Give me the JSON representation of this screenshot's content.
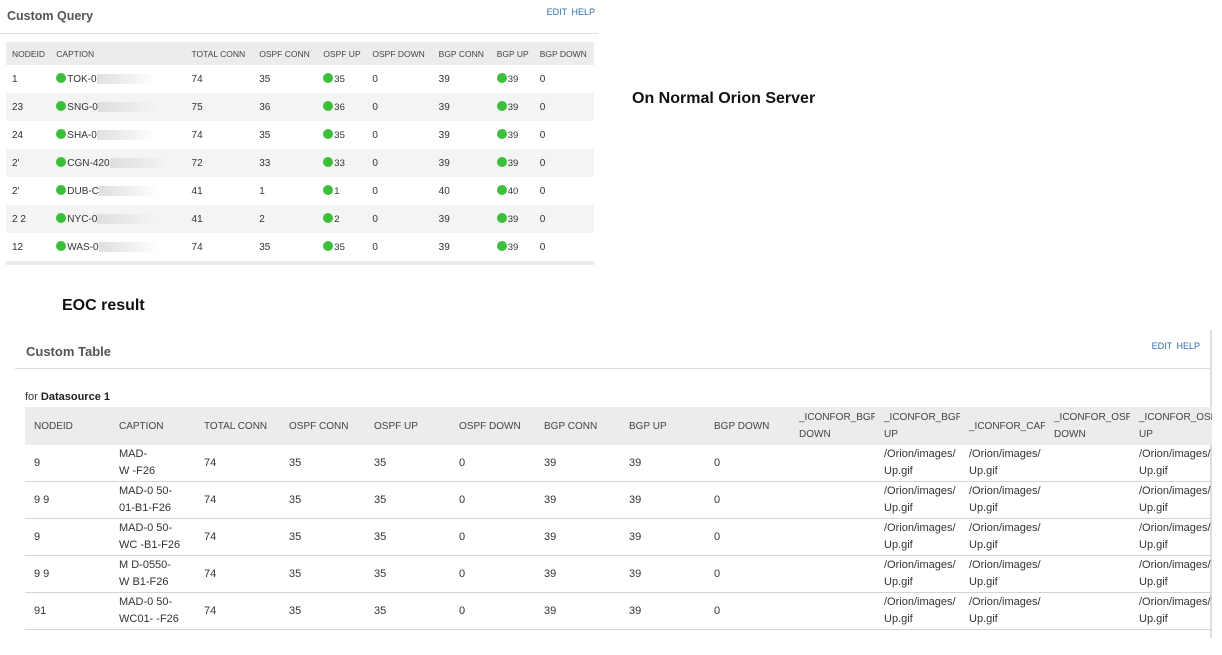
{
  "custom_query": {
    "title": "Custom Query",
    "edit_label": "EDIT",
    "help_label": "HELP",
    "columns": [
      "NODEID",
      "CAPTION",
      "TOTAL CONN",
      "OSPF CONN",
      "OSPF UP",
      "OSPF DOWN",
      "BGP CONN",
      "BGP UP",
      "BGP DOWN"
    ],
    "rows": [
      {
        "nodeid": "1",
        "caption": "TOK-0",
        "caption_tail": "00",
        "total_conn": "74",
        "ospf_conn": "35",
        "ospf_up": "35",
        "ospf_down": "0",
        "bgp_conn": "39",
        "bgp_up": "39",
        "bgp_down": "0"
      },
      {
        "nodeid": "23",
        "caption": "SNG-0",
        "caption_tail": "",
        "total_conn": "75",
        "ospf_conn": "36",
        "ospf_up": "36",
        "ospf_down": "0",
        "bgp_conn": "39",
        "bgp_up": "39",
        "bgp_down": "0"
      },
      {
        "nodeid": "24",
        "caption": "SHA-0",
        "caption_tail": "",
        "total_conn": "74",
        "ospf_conn": "35",
        "ospf_up": "35",
        "ospf_down": "0",
        "bgp_conn": "39",
        "bgp_up": "39",
        "bgp_down": "0"
      },
      {
        "nodeid": "2'",
        "caption": "CGN-420",
        "caption_tail": "",
        "total_conn": "72",
        "ospf_conn": "33",
        "ospf_up": "33",
        "ospf_down": "0",
        "bgp_conn": "39",
        "bgp_up": "39",
        "bgp_down": "0"
      },
      {
        "nodeid": "2'",
        "caption": "DUB-C",
        "caption_tail": "",
        "total_conn": "41",
        "ospf_conn": "1",
        "ospf_up": "1",
        "ospf_down": "0",
        "bgp_conn": "40",
        "bgp_up": "40",
        "bgp_down": "0"
      },
      {
        "nodeid": "2 2",
        "caption": "NYC-0",
        "caption_tail": "",
        "total_conn": "41",
        "ospf_conn": "2",
        "ospf_up": "2",
        "ospf_down": "0",
        "bgp_conn": "39",
        "bgp_up": "39",
        "bgp_down": "0"
      },
      {
        "nodeid": "12",
        "caption": "WAS-0",
        "caption_tail": "",
        "total_conn": "74",
        "ospf_conn": "35",
        "ospf_up": "35",
        "ospf_down": "0",
        "bgp_conn": "39",
        "bgp_up": "39",
        "bgp_down": "0"
      }
    ],
    "status_color": "#3bbf3b"
  },
  "labels": {
    "normal": "On Normal Orion Server",
    "eoc": "EOC result"
  },
  "custom_table": {
    "title": "Custom Table",
    "edit_label": "EDIT",
    "help_label": "HELP",
    "datasource_prefix": "for",
    "datasource_name": "Datasource 1",
    "columns": [
      [
        "NODEID"
      ],
      [
        "CAPTION"
      ],
      [
        "TOTAL CONN"
      ],
      [
        "OSPF CONN"
      ],
      [
        "OSPF UP"
      ],
      [
        "OSPF DOWN"
      ],
      [
        "BGP CONN"
      ],
      [
        "BGP UP"
      ],
      [
        "BGP DOWN"
      ],
      [
        "_ICONFOR_BGP",
        "DOWN"
      ],
      [
        "_ICONFOR_BGP",
        "UP"
      ],
      [
        "_ICONFOR_CAPTI"
      ],
      [
        "_ICONFOR_OSPF",
        "DOWN"
      ],
      [
        "_ICONFOR_OSPF",
        "UP"
      ]
    ],
    "rows": [
      {
        "nodeid": "9",
        "caption1": "MAD-",
        "caption2": "W  -F26",
        "total_conn": "74",
        "ospf_conn": "35",
        "ospf_up": "35",
        "ospf_down": "0",
        "bgp_conn": "39",
        "bgp_up": "39",
        "bgp_down": "0",
        "icon_bgp_down": "",
        "icon_bgp_up": [
          "/Orion/images/",
          "Up.gif"
        ],
        "icon_caption": [
          "/Orion/images/",
          "Up.gif"
        ],
        "icon_ospf_down": "",
        "icon_ospf_up": [
          "/Orion/images/",
          "Up.gif"
        ]
      },
      {
        "nodeid": "9 9",
        "caption1": "MAD-0 50-",
        "caption2": "01-B1-F26",
        "total_conn": "74",
        "ospf_conn": "35",
        "ospf_up": "35",
        "ospf_down": "0",
        "bgp_conn": "39",
        "bgp_up": "39",
        "bgp_down": "0",
        "icon_bgp_down": "",
        "icon_bgp_up": [
          "/Orion/images/",
          "Up.gif"
        ],
        "icon_caption": [
          "/Orion/images/",
          "Up.gif"
        ],
        "icon_ospf_down": "",
        "icon_ospf_up": [
          "/Orion/images/",
          "Up.gif"
        ]
      },
      {
        "nodeid": "9",
        "caption1": "MAD-0 50-",
        "caption2": "WC -B1-F26",
        "total_conn": "74",
        "ospf_conn": "35",
        "ospf_up": "35",
        "ospf_down": "0",
        "bgp_conn": "39",
        "bgp_up": "39",
        "bgp_down": "0",
        "icon_bgp_down": "",
        "icon_bgp_up": [
          "/Orion/images/",
          "Up.gif"
        ],
        "icon_caption": [
          "/Orion/images/",
          "Up.gif"
        ],
        "icon_ospf_down": "",
        "icon_ospf_up": [
          "/Orion/images/",
          "Up.gif"
        ]
      },
      {
        "nodeid": "9 9",
        "caption1": "M D-0550-",
        "caption2": "W B1-F26",
        "total_conn": "74",
        "ospf_conn": "35",
        "ospf_up": "35",
        "ospf_down": "0",
        "bgp_conn": "39",
        "bgp_up": "39",
        "bgp_down": "0",
        "icon_bgp_down": "",
        "icon_bgp_up": [
          "/Orion/images/",
          "Up.gif"
        ],
        "icon_caption": [
          "/Orion/images/",
          "Up.gif"
        ],
        "icon_ospf_down": "",
        "icon_ospf_up": [
          "/Orion/images/",
          "Up.gif"
        ]
      },
      {
        "nodeid": "91",
        "caption1": "MAD-0 50-",
        "caption2": "WC01- -F26",
        "total_conn": "74",
        "ospf_conn": "35",
        "ospf_up": "35",
        "ospf_down": "0",
        "bgp_conn": "39",
        "bgp_up": "39",
        "bgp_down": "0",
        "icon_bgp_down": "",
        "icon_bgp_up": [
          "/Orion/images/",
          "Up.gif"
        ],
        "icon_caption": [
          "/Orion/images/",
          "Up.gif"
        ],
        "icon_ospf_down": "",
        "icon_ospf_up": [
          "/Orion/images/",
          "Up.gif"
        ]
      }
    ]
  }
}
